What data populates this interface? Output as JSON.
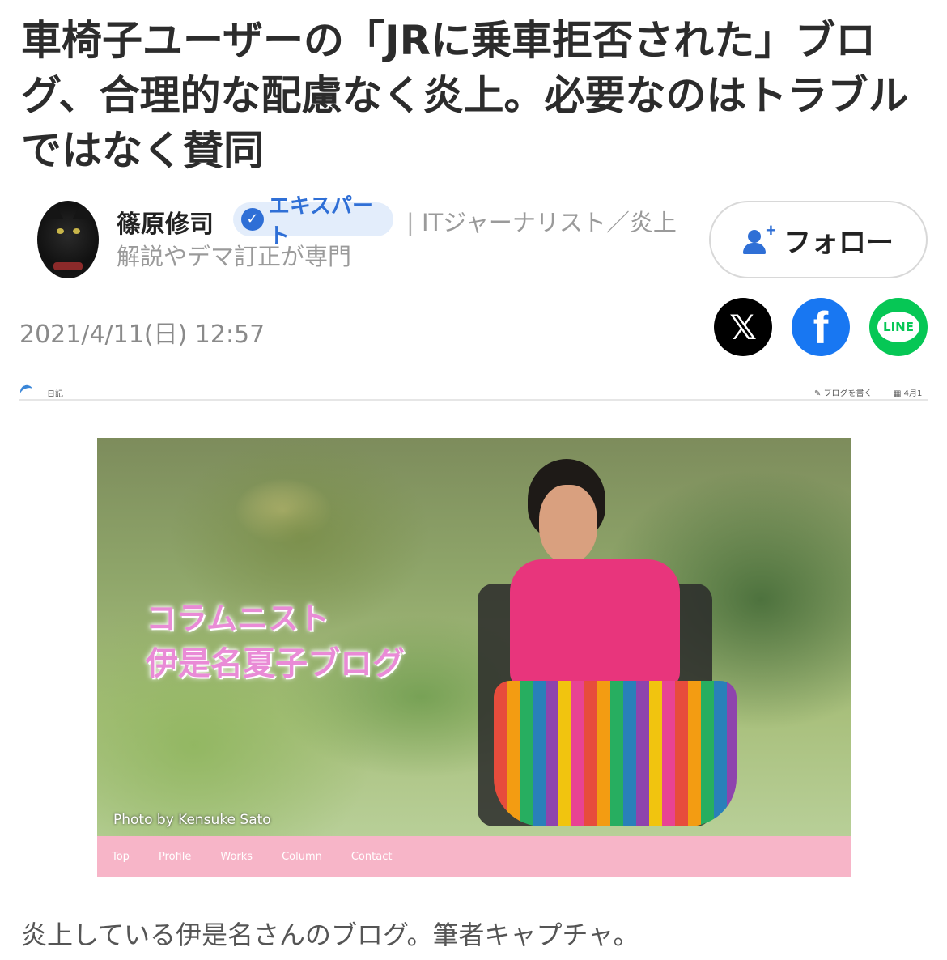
{
  "article": {
    "headline": "車椅子ユーザーの「JRに乗車拒否された」ブログ、合理的な配慮なく炎上。必要なのはトラブルではなく賛同",
    "date": "2021/4/11(日) 12:57",
    "caption": "炎上している伊是名さんのブログ。筆者キャプチャ。"
  },
  "author": {
    "name": "篠原修司",
    "badge": "エキスパート",
    "separator": "|",
    "title": "ITジャーナリスト／炎上解説やデマ訂正が専門",
    "follow_label": "フォロー"
  },
  "share": {
    "x_glyph": "𝕏",
    "facebook_glyph": "f",
    "line_label": "LINE"
  },
  "blog_screenshot": {
    "topbar_label": "日記",
    "write_label": "ブログを書く",
    "date_label": "4月1",
    "hero_title_line1": "コラムニスト",
    "hero_title_line2": "伊是名夏子ブログ",
    "photo_credit": "Photo by Kensuke Sato",
    "nav": [
      "Top",
      "Profile",
      "Works",
      "Column",
      "Contact"
    ]
  },
  "colors": {
    "accent_blue": "#2f6fd6",
    "facebook": "#1877f2",
    "line": "#06c755",
    "blog_nav_pink": "#f7b5c8"
  }
}
